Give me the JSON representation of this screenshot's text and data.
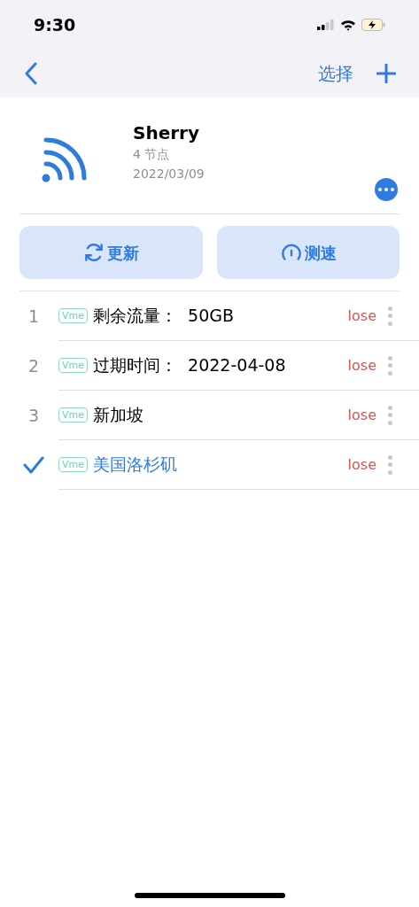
{
  "status_bar": {
    "time": "9:30"
  },
  "nav": {
    "action": "选择"
  },
  "subscription": {
    "name": "Sherry",
    "node_count": "4 节点",
    "date": "2022/03/09"
  },
  "buttons": [
    {
      "kind": "refresh",
      "label": "更新"
    },
    {
      "kind": "speed",
      "label": "测速"
    }
  ],
  "nodes": [
    {
      "number": "1",
      "tag": "Vme",
      "name": "剩余流量：  50GB",
      "latency": "lose",
      "selected": false
    },
    {
      "number": "2",
      "tag": "Vme",
      "name": "过期时间：  2022-04-08",
      "latency": "lose",
      "selected": false
    },
    {
      "number": "3",
      "tag": "Vme",
      "name": "新加坡",
      "latency": "lose",
      "selected": false
    },
    {
      "tag": "Vme",
      "name": "美国洛杉矶",
      "latency": "lose",
      "selected": true
    }
  ]
}
